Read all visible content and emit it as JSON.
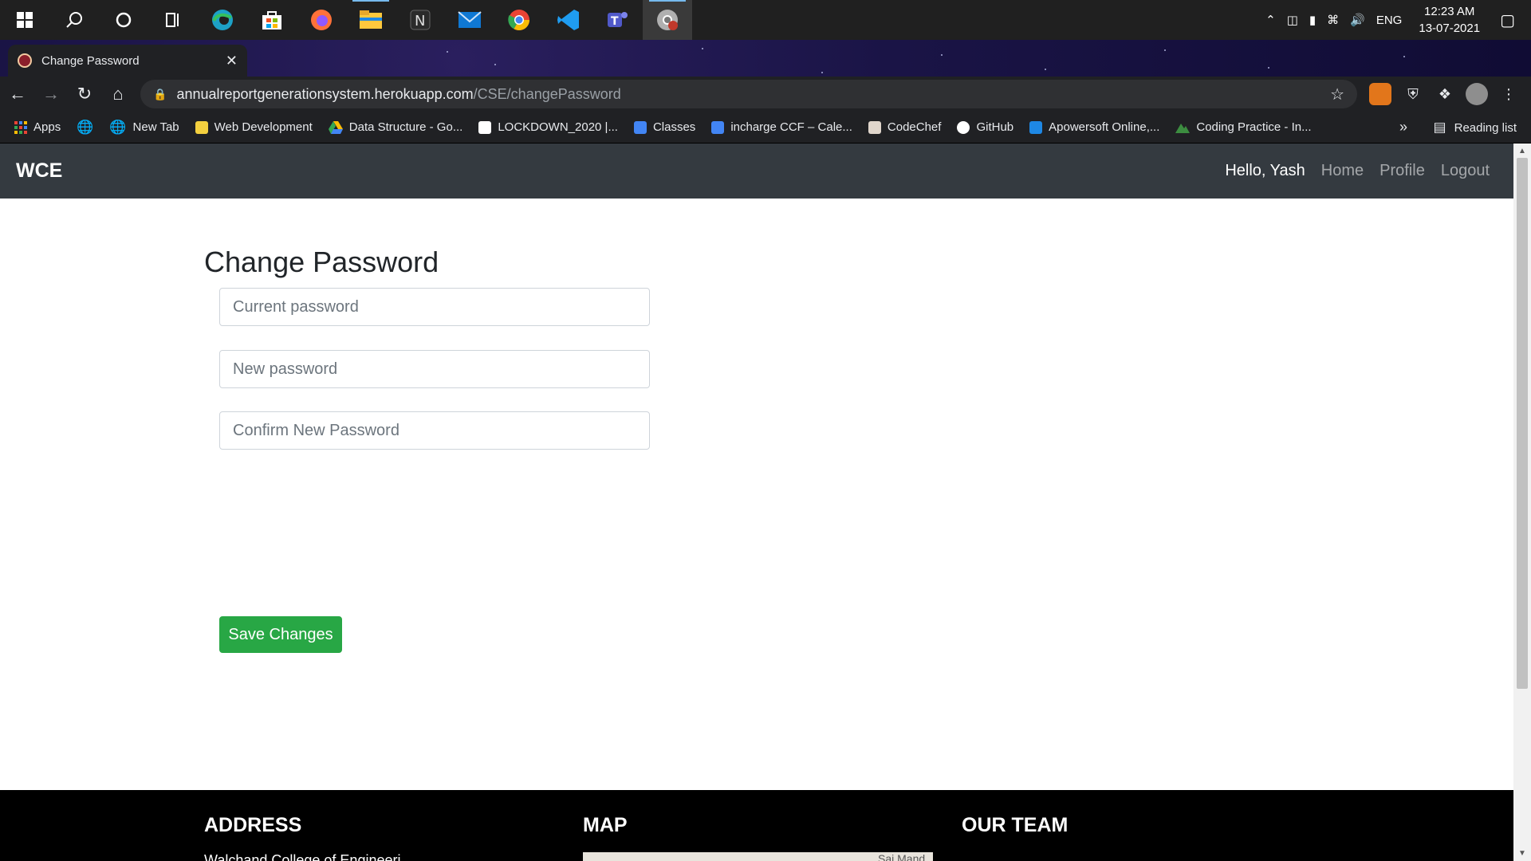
{
  "taskbar": {
    "icons": [
      "windows-start-icon",
      "search-icon",
      "cortana-icon",
      "task-view-icon",
      "edge-icon",
      "store-icon",
      "firefox-icon",
      "file-explorer-icon",
      "notion-icon",
      "mail-icon",
      "chrome-icon",
      "vscode-icon",
      "teams-icon",
      "chrome-profile-icon"
    ],
    "tray": {
      "language": "ENG",
      "time": "12:23 AM",
      "date": "13-07-2021"
    }
  },
  "browser": {
    "tab_title": "Change Password",
    "url_host": "annualreportgenerationsystem.herokuapp.com",
    "url_path": "/CSE/changePassword",
    "bookmarks": [
      {
        "label": "Apps",
        "color": "#ea4335"
      },
      {
        "label": "",
        "color": "#e8eaed"
      },
      {
        "label": "New Tab",
        "color": "#e8eaed"
      },
      {
        "label": "Web Development",
        "color": "#f4d03f"
      },
      {
        "label": "Data Structure - Go...",
        "color": "#34a853"
      },
      {
        "label": "LOCKDOWN_2020 |...",
        "color": "#ffffff"
      },
      {
        "label": "Classes",
        "color": "#4285f4"
      },
      {
        "label": "incharge CCF – Cale...",
        "color": "#4285f4"
      },
      {
        "label": "CodeChef",
        "color": "#8d6e63"
      },
      {
        "label": "GitHub",
        "color": "#ffffff"
      },
      {
        "label": "Apowersoft Online,...",
        "color": "#1e88e5"
      },
      {
        "label": "Coding Practice - In...",
        "color": "#3c8d40"
      }
    ],
    "more_bookmarks": "»",
    "reading_list": "Reading list"
  },
  "site": {
    "brand": "WCE",
    "greeting": "Hello, Yash",
    "nav": {
      "home": "Home",
      "profile": "Profile",
      "logout": "Logout"
    },
    "form": {
      "title": "Change Password",
      "current_placeholder": "Current password",
      "new_placeholder": "New password",
      "confirm_placeholder": "Confirm New Password",
      "save_label": "Save Changes"
    },
    "footer": {
      "address_heading": "ADDRESS",
      "map_heading": "MAP",
      "team_heading": "OUR TEAM",
      "address_partial": "Walchand College of Engineeri...",
      "map_label_partial": "Sai Mand"
    }
  },
  "colors": {
    "navbar": "#343a40",
    "success": "#28a745",
    "footer": "#000000"
  }
}
